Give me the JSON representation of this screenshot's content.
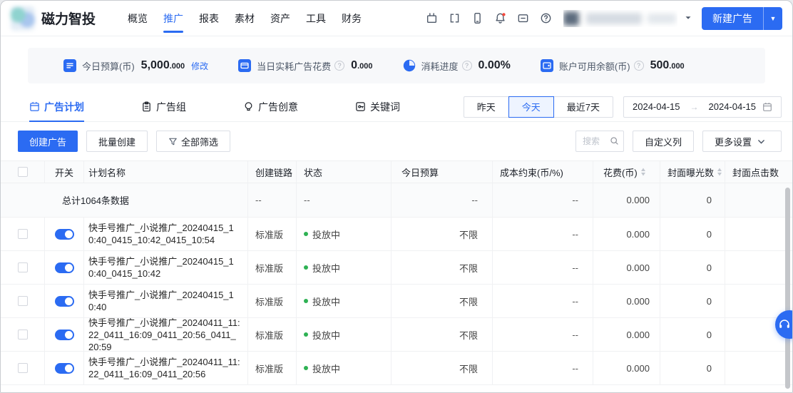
{
  "colors": {
    "accent": "#2b6bf2",
    "success": "#2eb153",
    "notification": "#f5483b"
  },
  "brand": {
    "name": "磁力智投"
  },
  "nav": {
    "items": [
      {
        "label": "概览",
        "active": false
      },
      {
        "label": "推广",
        "active": true
      },
      {
        "label": "报表",
        "active": false
      },
      {
        "label": "素材",
        "active": false
      },
      {
        "label": "资产",
        "active": false
      },
      {
        "label": "工具",
        "active": false
      },
      {
        "label": "财务",
        "active": false
      }
    ]
  },
  "topbar": {
    "icons": [
      "tv-icon",
      "window-switch-icon",
      "phone-icon",
      "bell-icon",
      "message-icon",
      "help-icon"
    ],
    "new_ad_label": "新建广告"
  },
  "stats": {
    "items": [
      {
        "icon": "budget-icon",
        "label": "今日预算(币)",
        "value": "5,000",
        "decimals": ".000",
        "action": "修改",
        "help": false
      },
      {
        "icon": "spend-icon",
        "label": "当日实耗广告花费",
        "value": "0",
        "decimals": ".000",
        "help": true
      },
      {
        "icon": "progress-icon",
        "label": "消耗进度",
        "value": "0.00%",
        "decimals": "",
        "help": true
      },
      {
        "icon": "balance-icon",
        "label": "账户可用余额(币)",
        "value": "500",
        "decimals": ".000",
        "help": true
      }
    ]
  },
  "tabs": {
    "items": [
      {
        "label": "广告计划",
        "active": true
      },
      {
        "label": "广告组",
        "active": false
      },
      {
        "label": "广告创意",
        "active": false
      },
      {
        "label": "关键词",
        "active": false
      }
    ]
  },
  "date_filter": {
    "presets": [
      {
        "label": "昨天",
        "active": false
      },
      {
        "label": "今天",
        "active": true
      },
      {
        "label": "最近7天",
        "active": false
      }
    ],
    "start": "2024-04-15",
    "end": "2024-04-15",
    "arrow": "→"
  },
  "toolbar": {
    "create": "创建广告",
    "batch_create": "批量创建",
    "filter_all": "全部筛选",
    "search_placeholder": "搜索",
    "custom_columns": "自定义列",
    "more_settings": "更多设置"
  },
  "table": {
    "columns": [
      "开关",
      "计划名称",
      "创建链路",
      "状态",
      "今日预算",
      "成本约束(币/%)",
      "花费(币)",
      "封面曝光数",
      "封面点击数"
    ],
    "sortable_columns": [
      "花费(币)",
      "封面曝光数"
    ],
    "summary": {
      "label": "总计1064条数据",
      "link": "--",
      "status": "--",
      "budget": "--",
      "cost": "--",
      "spend": "0.000",
      "impressions": "0",
      "clicks": ""
    },
    "rows": [
      {
        "enabled": true,
        "name": "快手号推广_小说推广_20240415_10:40_0415_10:42_0415_10:54",
        "link": "标准版",
        "status": "投放中",
        "budget": "不限",
        "cost": "--",
        "spend": "0.000",
        "impressions": "0",
        "clicks": ""
      },
      {
        "enabled": true,
        "name": "快手号推广_小说推广_20240415_10:40_0415_10:42",
        "link": "标准版",
        "status": "投放中",
        "budget": "不限",
        "cost": "--",
        "spend": "0.000",
        "impressions": "0",
        "clicks": ""
      },
      {
        "enabled": true,
        "name": "快手号推广_小说推广_20240415_10:40",
        "link": "标准版",
        "status": "投放中",
        "budget": "不限",
        "cost": "--",
        "spend": "0.000",
        "impressions": "0",
        "clicks": ""
      },
      {
        "enabled": true,
        "name": "快手号推广_小说推广_20240411_11:22_0411_16:09_0411_20:56_0411_20:59",
        "link": "标准版",
        "status": "投放中",
        "budget": "不限",
        "cost": "--",
        "spend": "0.000",
        "impressions": "0",
        "clicks": ""
      },
      {
        "enabled": true,
        "name": "快手号推广_小说推广_20240411_11:22_0411_16:09_0411_20:56",
        "link": "标准版",
        "status": "投放中",
        "budget": "不限",
        "cost": "--",
        "spend": "0.000",
        "impressions": "0",
        "clicks": ""
      }
    ]
  }
}
